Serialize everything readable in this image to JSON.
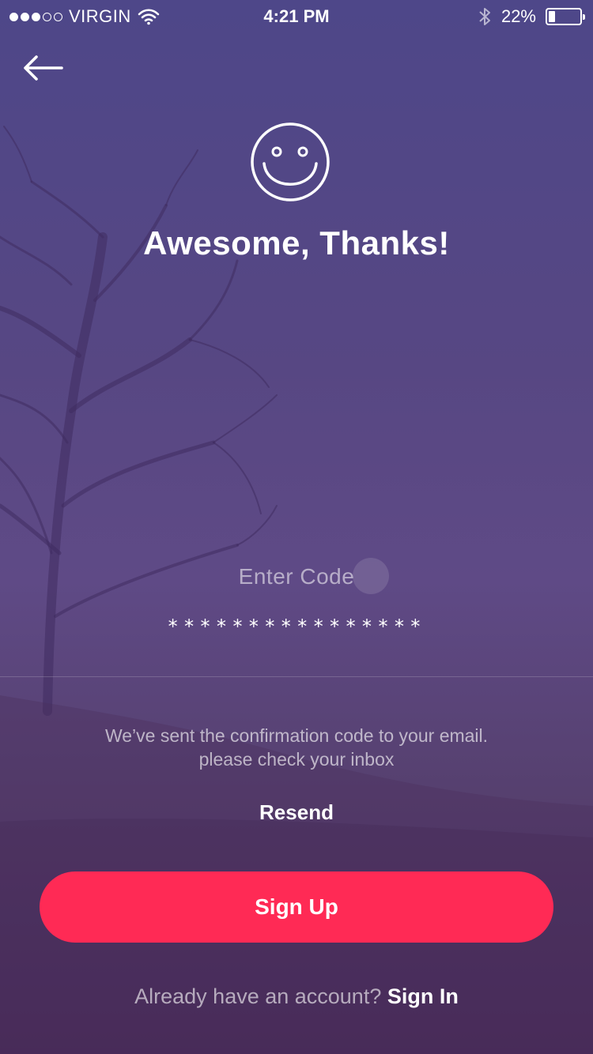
{
  "status_bar": {
    "carrier": "VIRGIN",
    "time": "4:21 PM",
    "battery_percent": "22%",
    "battery_level": 0.22,
    "signal_strength": 3,
    "signal_max": 5,
    "icons": [
      "wifi-icon",
      "bluetooth-icon",
      "battery-icon"
    ]
  },
  "header": {
    "back_icon": "arrow-left-icon",
    "emoji_icon": "smiley-icon",
    "title": "Awesome, Thanks!"
  },
  "code_field": {
    "label": "Enter Code",
    "value": "****************"
  },
  "info": {
    "line1": "We’ve sent the confirmation code to your email.",
    "line2": "please check your inbox"
  },
  "actions": {
    "resend_label": "Resend",
    "signup_label": "Sign Up"
  },
  "footer": {
    "prompt": "Already have an account?",
    "signin_label": "Sign In"
  },
  "colors": {
    "primary_button": "#ff2a55",
    "background_top": "#4e4789",
    "background_bottom": "#4c2f5e"
  }
}
